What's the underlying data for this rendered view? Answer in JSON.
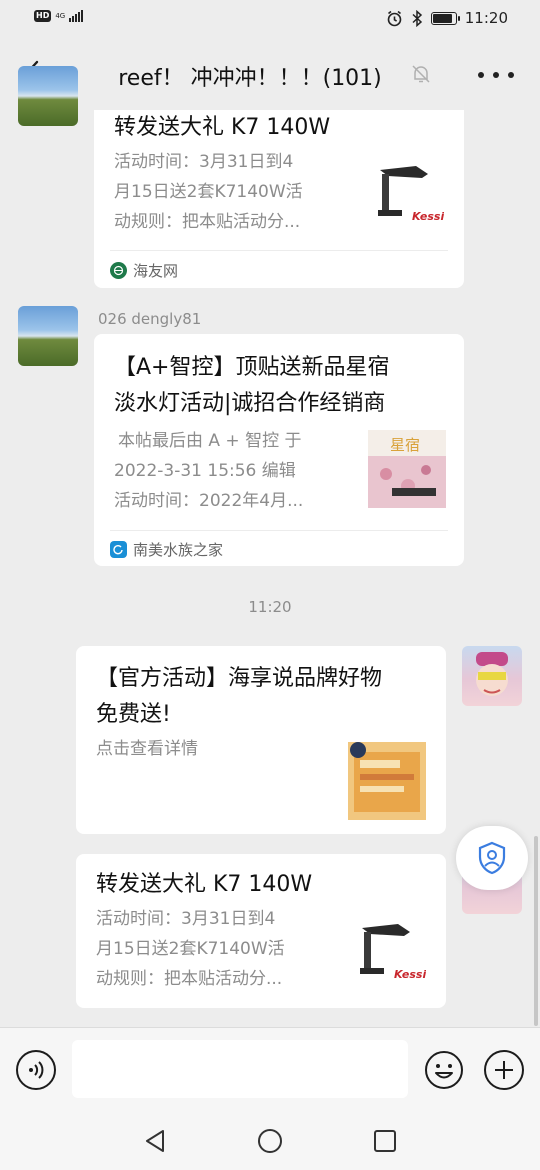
{
  "status_bar": {
    "hd": "HD",
    "network": "4G",
    "time": "11:20",
    "battery_level": 0.8
  },
  "nav": {
    "title": "reef！ 冲冲冲！！！(101)"
  },
  "messages": [
    {
      "title": "转发送大礼 K7 140W",
      "desc": [
        "活动时间：3月31日到4",
        "月15日送2套K7140W活",
        "动规则：把本贴活动分..."
      ],
      "source": "海友网",
      "thumb_text": "Kessil KP"
    },
    {
      "sender": "026 dengly81",
      "title": [
        "【A+智控】顶贴送新品星宿",
        "淡水灯活动|诚招合作经销商"
      ],
      "desc": [
        "本帖最后由 A + 智控 于",
        "2022-3-31 15:56 编辑",
        "活动时间：2022年4月..."
      ],
      "source": "南美水族之家",
      "thumb_text": "星宿"
    },
    {
      "time_divider": "11:20"
    },
    {
      "title": [
        "【官方活动】海享说品牌好物",
        "免费送!"
      ],
      "desc": [
        "点击查看详情"
      ]
    },
    {
      "title": "转发送大礼 K7 140W",
      "desc": [
        "活动时间：3月31日到4",
        "月15日送2套K7140W活",
        "动规则：把本贴活动分..."
      ],
      "thumb_text": "Kessil KP"
    }
  ],
  "input": {
    "placeholder": ""
  },
  "colors": {
    "background": "#ededed",
    "card": "#ffffff",
    "muted_text": "#8c8c8c",
    "source_icon_blue": "#1a8fd6",
    "source_icon_green": "#1f7a4a"
  },
  "icons": [
    "back-icon",
    "mute-bell-icon",
    "more-icon",
    "voice-icon",
    "emoji-icon",
    "plus-icon",
    "shield-user-icon",
    "nav-back-triangle-icon",
    "nav-home-circle-icon",
    "nav-recents-square-icon"
  ]
}
